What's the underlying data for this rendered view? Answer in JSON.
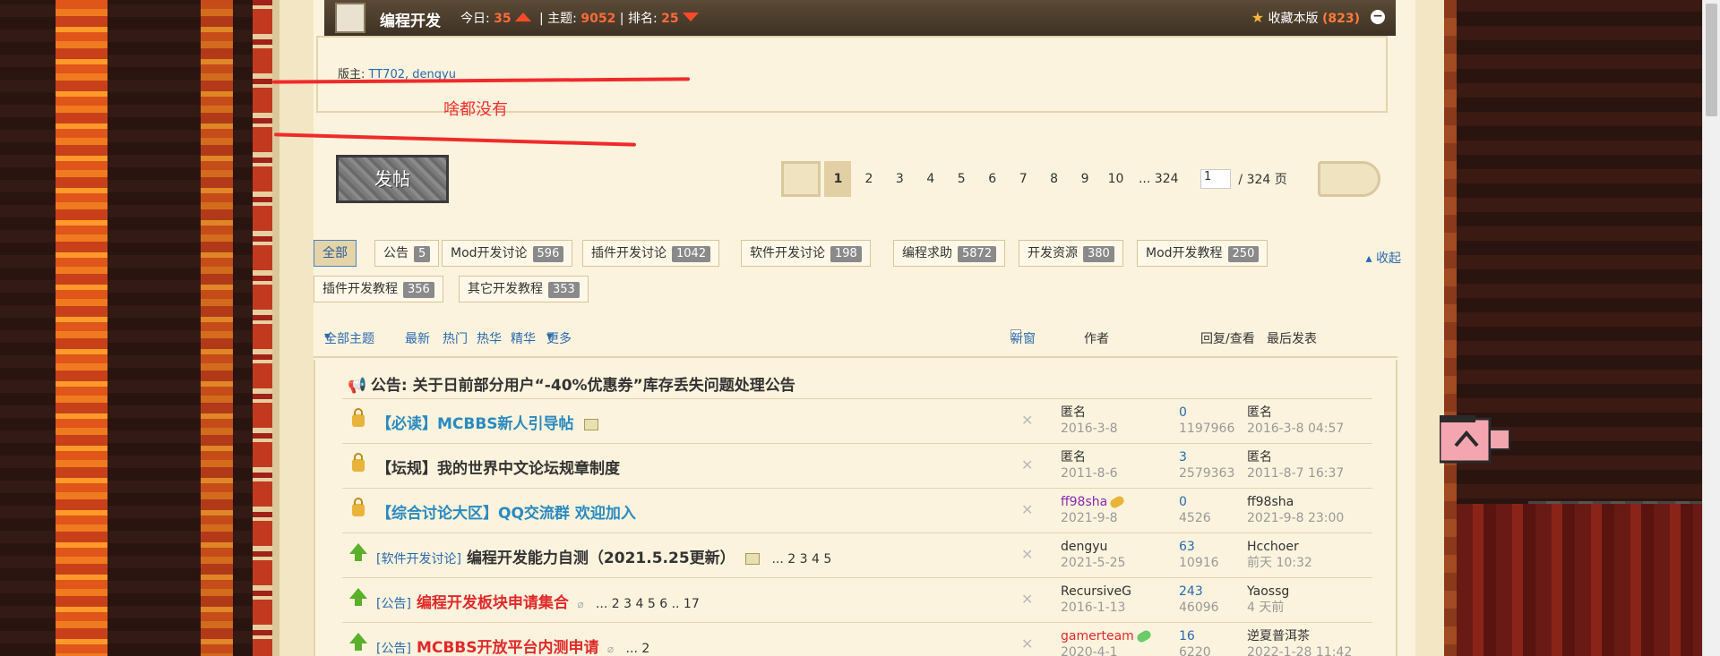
{
  "header": {
    "forum_name": "编程开发",
    "today_label": "今日:",
    "today_value": "35",
    "topics_label": "| 主题:",
    "topics_value": "9052",
    "rank_label": "| 排名:",
    "rank_value": "25",
    "fav_label": "收藏本版",
    "fav_count": "(823)"
  },
  "moderators": {
    "label": "版主:",
    "names": "TT702, dengyu"
  },
  "annotation": "啥都没有",
  "post_button": "发帖",
  "pager": {
    "pages": [
      "1",
      "2",
      "3",
      "4",
      "5",
      "6",
      "7",
      "8",
      "9",
      "10",
      "... 324"
    ],
    "input_value": "1",
    "total": "/ 324 页"
  },
  "categories": [
    {
      "label": "全部",
      "count": ""
    },
    {
      "label": "公告",
      "count": "5"
    },
    {
      "label": "Mod开发讨论",
      "count": "596"
    },
    {
      "label": "插件开发讨论",
      "count": "1042"
    },
    {
      "label": "软件开发讨论",
      "count": "198"
    },
    {
      "label": "编程求助",
      "count": "5872"
    },
    {
      "label": "开发资源",
      "count": "380"
    },
    {
      "label": "Mod开发教程",
      "count": "250"
    },
    {
      "label": "插件开发教程",
      "count": "356"
    },
    {
      "label": "其它开发教程",
      "count": "353"
    }
  ],
  "collapse_label": "收起",
  "filter": {
    "all": "全部主题",
    "latest": "最新",
    "hot": "热门",
    "hot_posts": "热华",
    "digest": "精华",
    "more": "更多",
    "new_window": "新窗",
    "author": "作者",
    "replies_views": "回复/查看",
    "last_post": "最后发表"
  },
  "announcement": "公告: 关于日前部分用户“-40%优惠券”库存丢失问题处理公告",
  "threads": [
    {
      "tag": "",
      "title": "【必读】MCBBS新人引导帖",
      "pages": "",
      "author": "匿名",
      "date": "2016-3-8",
      "replies": "0",
      "views": "1197966",
      "last_user": "匿名",
      "last_date": "2016-3-8 04:57"
    },
    {
      "tag": "",
      "title": "【坛规】我的世界中文论坛规章制度",
      "pages": "",
      "author": "匿名",
      "date": "2011-8-6",
      "replies": "3",
      "views": "2579363",
      "last_user": "匿名",
      "last_date": "2011-8-7 16:37"
    },
    {
      "tag": "",
      "title": "【综合讨论大区】QQ交流群 欢迎加入",
      "pages": "",
      "author": "ff98sha",
      "date": "2021-9-8",
      "replies": "0",
      "views": "4526",
      "last_user": "ff98sha",
      "last_date": "2021-9-8 23:00"
    },
    {
      "tag": "[软件开发讨论]",
      "title": "编程开发能力自测（2021.5.25更新）",
      "pages": "... 2 3 4 5",
      "author": "dengyu",
      "date": "2021-5-25",
      "replies": "63",
      "views": "10916",
      "last_user": "Hcchoer",
      "last_date": "前天 10:32"
    },
    {
      "tag": "[公告]",
      "title": "编程开发板块申请集合",
      "pages": "... 2 3 4 5 6 .. 17",
      "author": "RecursiveG",
      "date": "2016-1-13",
      "replies": "243",
      "views": "46096",
      "last_user": "Yaossg",
      "last_date": "4 天前"
    },
    {
      "tag": "[公告]",
      "title": "MCBBS开放平台内测申请",
      "pages": "... 2",
      "author": "gamerteam",
      "date": "2020-4-1",
      "replies": "16",
      "views": "6220",
      "last_user": "逆夏普洱茶",
      "last_date": "2022-1-28 11:42"
    }
  ]
}
